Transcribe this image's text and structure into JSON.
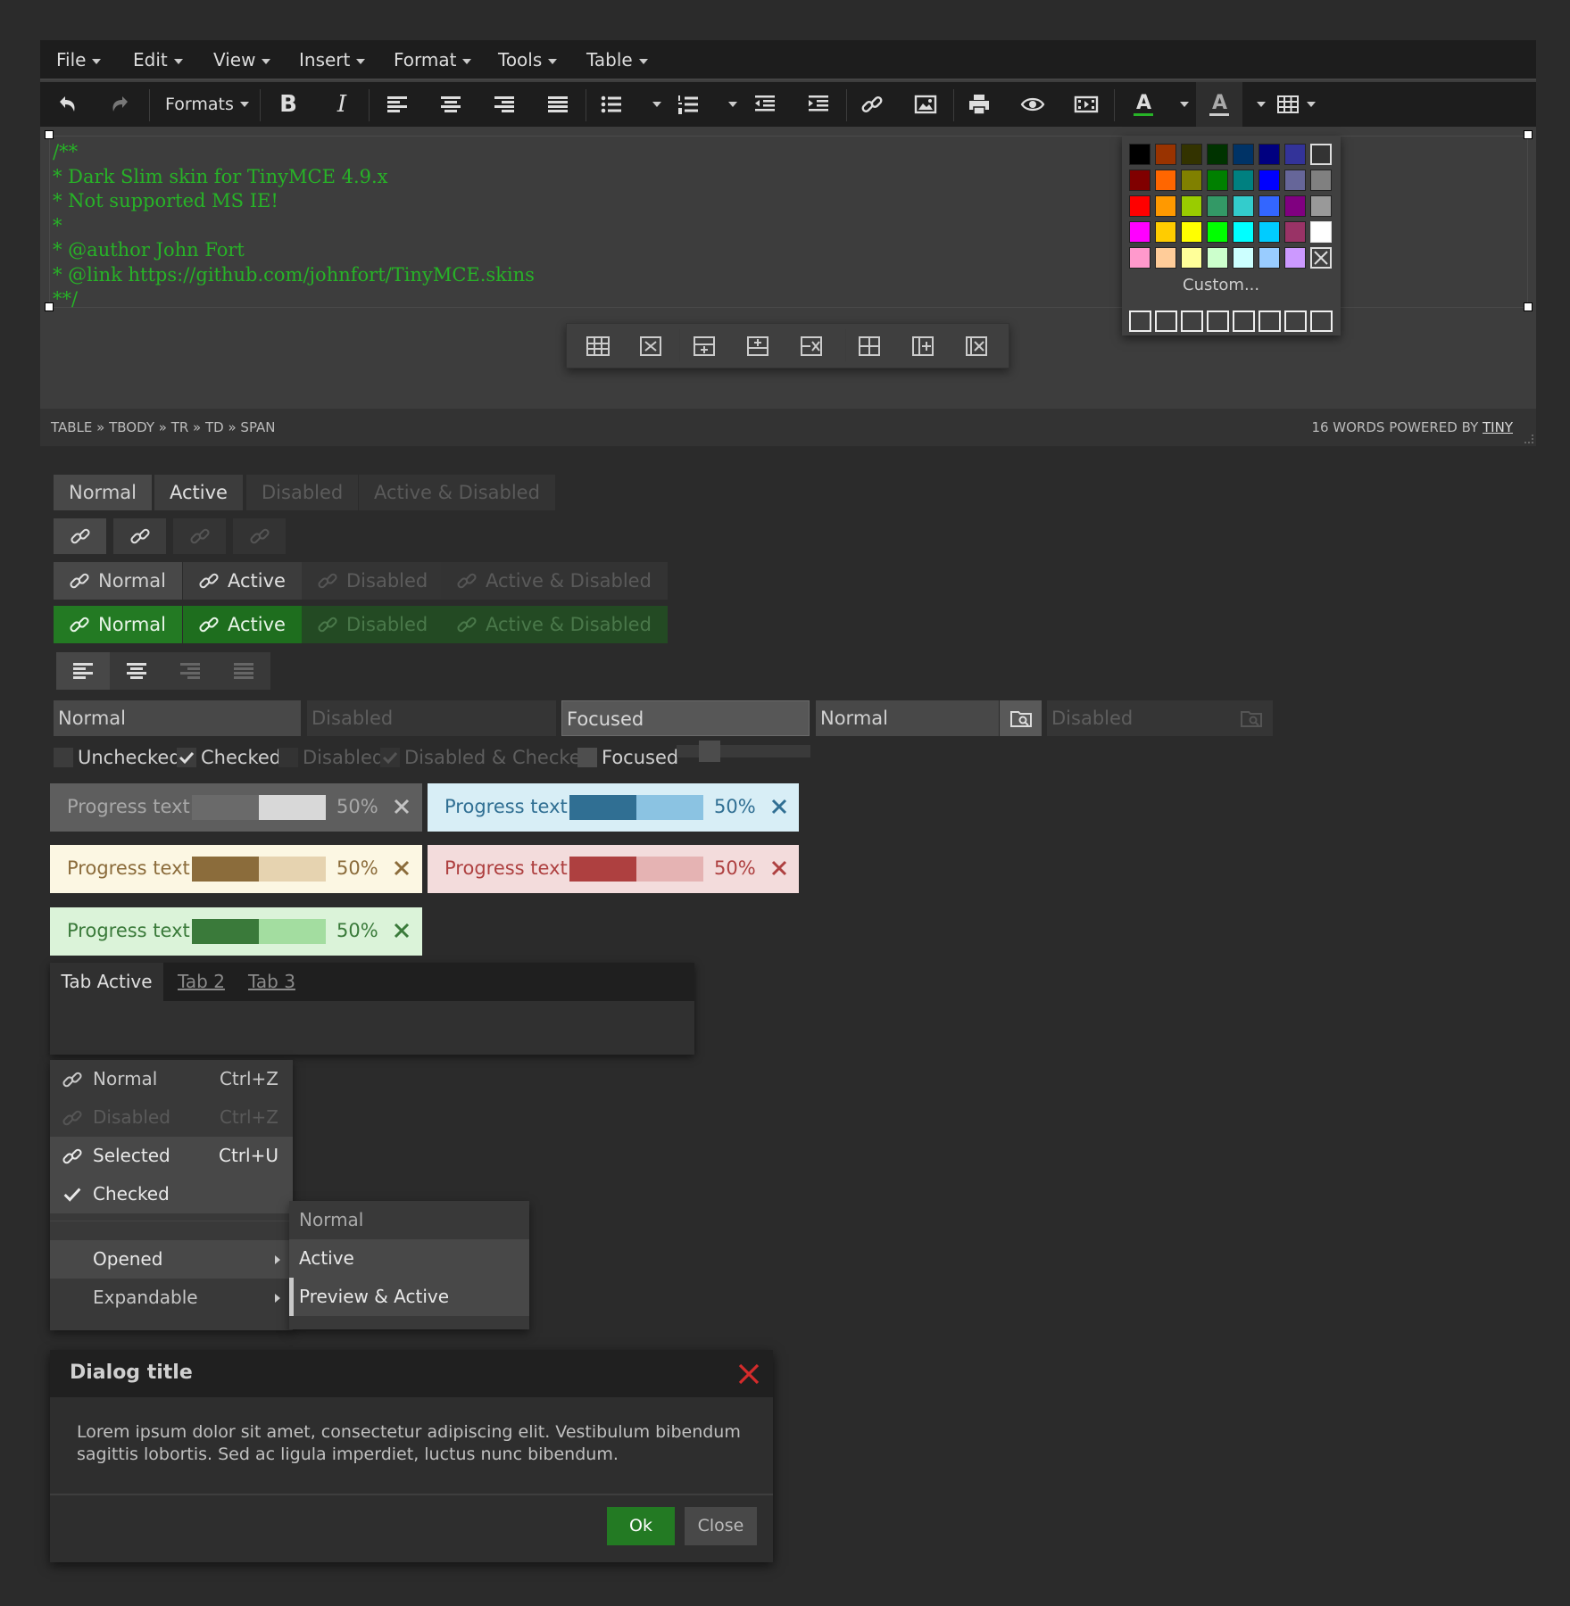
{
  "menubar": {
    "items": [
      "File",
      "Edit",
      "View",
      "Insert",
      "Format",
      "Tools",
      "Table"
    ]
  },
  "toolbar": {
    "formats_label": "Formats",
    "icons": [
      "undo-icon",
      "redo-icon",
      "bold-icon",
      "italic-icon",
      "align-left-icon",
      "align-center-icon",
      "align-right-icon",
      "align-justify-icon",
      "bullet-list-icon",
      "numbered-list-icon",
      "outdent-icon",
      "indent-icon",
      "link-icon",
      "image-icon",
      "print-icon",
      "preview-icon",
      "media-icon",
      "text-color-icon",
      "background-color-icon",
      "table-icon"
    ]
  },
  "content": {
    "lines": [
      "/**",
      "* Dark Slim skin for TinyMCE 4.9.x",
      "* Not supported MS IE!",
      "*",
      "* @author John Fort",
      "* @link https://github.com/johnfort/TinyMCE.skins",
      "**/"
    ],
    "text_color": "#27b327"
  },
  "colorpanel": {
    "custom_label": "Custom...",
    "rows": [
      [
        "#000000",
        "#993300",
        "#333300",
        "#003300",
        "#003366",
        "#000080",
        "#333399",
        "#333333"
      ],
      [
        "#800000",
        "#ff6600",
        "#808000",
        "#008000",
        "#008080",
        "#0000ff",
        "#666699",
        "#808080"
      ],
      [
        "#ff0000",
        "#ff9900",
        "#99cc00",
        "#339966",
        "#33cccc",
        "#3366ff",
        "#800080",
        "#999999"
      ],
      [
        "#ff00ff",
        "#ffcc00",
        "#ffff00",
        "#00ff00",
        "#00ffff",
        "#00ccff",
        "#993366",
        "#ffffff"
      ],
      [
        "#ff99cc",
        "#ffcc99",
        "#ffff99",
        "#ccffcc",
        "#ccffff",
        "#99ccff",
        "#cc99ff",
        "none"
      ]
    ]
  },
  "statusbar": {
    "path": "TABLE » TBODY » TR » TD » SPAN",
    "wordcount": "16 WORDS",
    "powered_prefix": "POWERED BY",
    "powered_link": "TINY"
  },
  "buttons": {
    "normal": "Normal",
    "active": "Active",
    "disabled": "Disabled",
    "active_disabled": "Active & Disabled"
  },
  "inputs": {
    "normal": "Normal",
    "disabled": "Disabled",
    "focused": "Focused",
    "combo_normal": "Normal",
    "combo_disabled": "Disabled"
  },
  "checkboxes": {
    "unchecked": "Unchecked",
    "checked": "Checked",
    "disabled": "Disabled",
    "disabled_checked": "Disabled & Checked",
    "focused": "Focused"
  },
  "slider": {
    "value": 0.2
  },
  "progress": {
    "label": "Progress text",
    "percent_text": "50%",
    "value": 0.5
  },
  "tabs": {
    "active": "Tab Active",
    "tab2": "Tab 2",
    "tab3": "Tab 3"
  },
  "menu": {
    "normal": "Normal",
    "normal_shortcut": "Ctrl+Z",
    "disabled": "Disabled",
    "disabled_shortcut": "Ctrl+Z",
    "selected": "Selected",
    "selected_shortcut": "Ctrl+U",
    "checked": "Checked",
    "opened": "Opened",
    "expandable": "Expandable"
  },
  "submenu": {
    "normal": "Normal",
    "active": "Active",
    "preview_active": "Preview & Active"
  },
  "dialog": {
    "title": "Dialog title",
    "body": "Lorem ipsum dolor sit amet, consectetur adipiscing elit. Vestibulum bibendum sagittis lobortis. Sed ac ligula imperdiet, luctus nunc bibendum.",
    "ok": "Ok",
    "close": "Close"
  }
}
